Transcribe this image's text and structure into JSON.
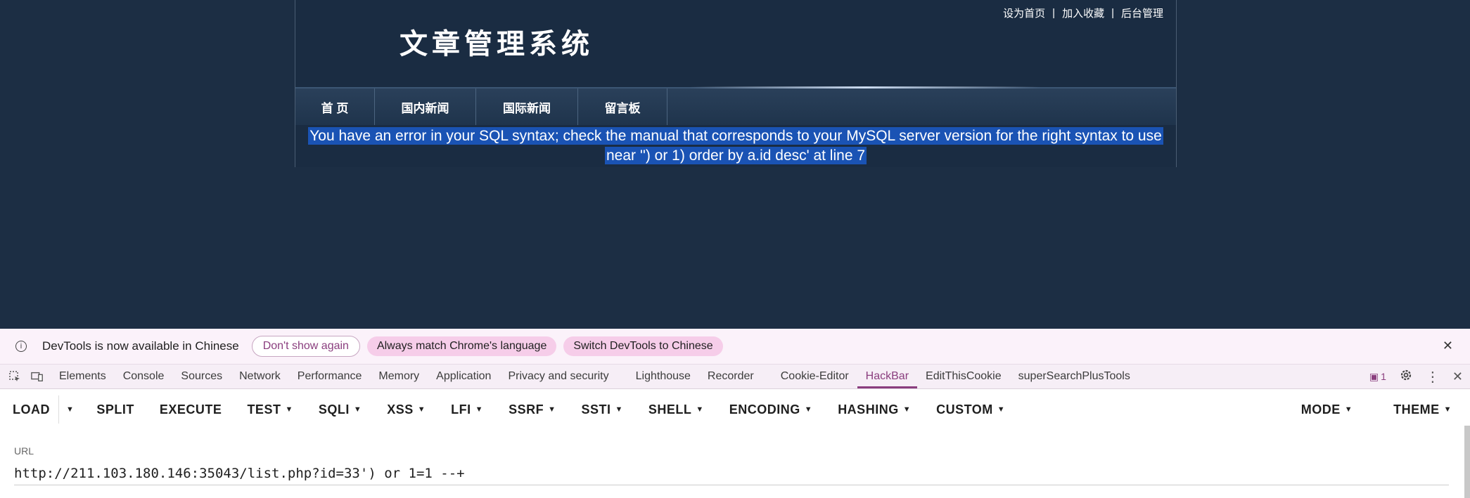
{
  "site": {
    "title": "文章管理系统",
    "top_links": [
      "设为首页",
      "加入收藏",
      "后台管理"
    ],
    "separator": "|",
    "nav": [
      "首 页",
      "国内新闻",
      "国际新闻",
      "留言板"
    ],
    "error_line1": "You have an error in your SQL syntax; check the manual that corresponds to your MySQL server version for the right syntax to use",
    "error_line2": "near '') or 1) order by a.id desc' at line 7"
  },
  "devtools": {
    "infobar": {
      "info_icon": "info-icon",
      "message": "DevTools is now available in Chinese",
      "dont_show": "Don't show again",
      "always_match": "Always match Chrome's language",
      "switch": "Switch DevTools to Chinese",
      "close": "✕"
    },
    "tabs": [
      "Elements",
      "Console",
      "Sources",
      "Network",
      "Performance",
      "Memory",
      "Application",
      "Privacy and security",
      "Lighthouse",
      "Recorder",
      "Cookie-Editor",
      "HackBar",
      "EditThisCookie",
      "superSearchPlusTools"
    ],
    "active_tab": "HackBar",
    "issues_count": "1",
    "hackbar": {
      "load": "LOAD",
      "split": "SPLIT",
      "execute": "EXECUTE",
      "test": "TEST",
      "sqli": "SQLI",
      "xss": "XSS",
      "lfi": "LFI",
      "ssrf": "SSRF",
      "ssti": "SSTI",
      "shell": "SHELL",
      "encoding": "ENCODING",
      "hashing": "HASHING",
      "custom": "CUSTOM",
      "mode": "MODE",
      "theme": "THEME"
    },
    "url_label": "URL",
    "url_value": "http://211.103.180.146:35043/list.php?id=33') or 1=1 --+"
  },
  "colors": {
    "page_bg": "#1c2e44",
    "selection": "#1a53b4",
    "accent": "#8a3e7e"
  }
}
